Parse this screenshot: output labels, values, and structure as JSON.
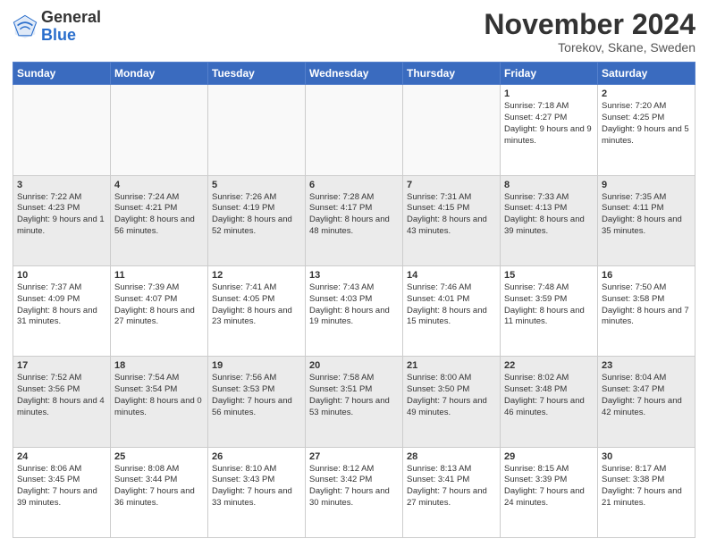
{
  "header": {
    "logo_general": "General",
    "logo_blue": "Blue",
    "month": "November 2024",
    "location": "Torekov, Skane, Sweden"
  },
  "days_of_week": [
    "Sunday",
    "Monday",
    "Tuesday",
    "Wednesday",
    "Thursday",
    "Friday",
    "Saturday"
  ],
  "weeks": [
    [
      {
        "day": "",
        "info": ""
      },
      {
        "day": "",
        "info": ""
      },
      {
        "day": "",
        "info": ""
      },
      {
        "day": "",
        "info": ""
      },
      {
        "day": "",
        "info": ""
      },
      {
        "day": "1",
        "info": "Sunrise: 7:18 AM\nSunset: 4:27 PM\nDaylight: 9 hours and 9 minutes."
      },
      {
        "day": "2",
        "info": "Sunrise: 7:20 AM\nSunset: 4:25 PM\nDaylight: 9 hours and 5 minutes."
      }
    ],
    [
      {
        "day": "3",
        "info": "Sunrise: 7:22 AM\nSunset: 4:23 PM\nDaylight: 9 hours and 1 minute."
      },
      {
        "day": "4",
        "info": "Sunrise: 7:24 AM\nSunset: 4:21 PM\nDaylight: 8 hours and 56 minutes."
      },
      {
        "day": "5",
        "info": "Sunrise: 7:26 AM\nSunset: 4:19 PM\nDaylight: 8 hours and 52 minutes."
      },
      {
        "day": "6",
        "info": "Sunrise: 7:28 AM\nSunset: 4:17 PM\nDaylight: 8 hours and 48 minutes."
      },
      {
        "day": "7",
        "info": "Sunrise: 7:31 AM\nSunset: 4:15 PM\nDaylight: 8 hours and 43 minutes."
      },
      {
        "day": "8",
        "info": "Sunrise: 7:33 AM\nSunset: 4:13 PM\nDaylight: 8 hours and 39 minutes."
      },
      {
        "day": "9",
        "info": "Sunrise: 7:35 AM\nSunset: 4:11 PM\nDaylight: 8 hours and 35 minutes."
      }
    ],
    [
      {
        "day": "10",
        "info": "Sunrise: 7:37 AM\nSunset: 4:09 PM\nDaylight: 8 hours and 31 minutes."
      },
      {
        "day": "11",
        "info": "Sunrise: 7:39 AM\nSunset: 4:07 PM\nDaylight: 8 hours and 27 minutes."
      },
      {
        "day": "12",
        "info": "Sunrise: 7:41 AM\nSunset: 4:05 PM\nDaylight: 8 hours and 23 minutes."
      },
      {
        "day": "13",
        "info": "Sunrise: 7:43 AM\nSunset: 4:03 PM\nDaylight: 8 hours and 19 minutes."
      },
      {
        "day": "14",
        "info": "Sunrise: 7:46 AM\nSunset: 4:01 PM\nDaylight: 8 hours and 15 minutes."
      },
      {
        "day": "15",
        "info": "Sunrise: 7:48 AM\nSunset: 3:59 PM\nDaylight: 8 hours and 11 minutes."
      },
      {
        "day": "16",
        "info": "Sunrise: 7:50 AM\nSunset: 3:58 PM\nDaylight: 8 hours and 7 minutes."
      }
    ],
    [
      {
        "day": "17",
        "info": "Sunrise: 7:52 AM\nSunset: 3:56 PM\nDaylight: 8 hours and 4 minutes."
      },
      {
        "day": "18",
        "info": "Sunrise: 7:54 AM\nSunset: 3:54 PM\nDaylight: 8 hours and 0 minutes."
      },
      {
        "day": "19",
        "info": "Sunrise: 7:56 AM\nSunset: 3:53 PM\nDaylight: 7 hours and 56 minutes."
      },
      {
        "day": "20",
        "info": "Sunrise: 7:58 AM\nSunset: 3:51 PM\nDaylight: 7 hours and 53 minutes."
      },
      {
        "day": "21",
        "info": "Sunrise: 8:00 AM\nSunset: 3:50 PM\nDaylight: 7 hours and 49 minutes."
      },
      {
        "day": "22",
        "info": "Sunrise: 8:02 AM\nSunset: 3:48 PM\nDaylight: 7 hours and 46 minutes."
      },
      {
        "day": "23",
        "info": "Sunrise: 8:04 AM\nSunset: 3:47 PM\nDaylight: 7 hours and 42 minutes."
      }
    ],
    [
      {
        "day": "24",
        "info": "Sunrise: 8:06 AM\nSunset: 3:45 PM\nDaylight: 7 hours and 39 minutes."
      },
      {
        "day": "25",
        "info": "Sunrise: 8:08 AM\nSunset: 3:44 PM\nDaylight: 7 hours and 36 minutes."
      },
      {
        "day": "26",
        "info": "Sunrise: 8:10 AM\nSunset: 3:43 PM\nDaylight: 7 hours and 33 minutes."
      },
      {
        "day": "27",
        "info": "Sunrise: 8:12 AM\nSunset: 3:42 PM\nDaylight: 7 hours and 30 minutes."
      },
      {
        "day": "28",
        "info": "Sunrise: 8:13 AM\nSunset: 3:41 PM\nDaylight: 7 hours and 27 minutes."
      },
      {
        "day": "29",
        "info": "Sunrise: 8:15 AM\nSunset: 3:39 PM\nDaylight: 7 hours and 24 minutes."
      },
      {
        "day": "30",
        "info": "Sunrise: 8:17 AM\nSunset: 3:38 PM\nDaylight: 7 hours and 21 minutes."
      }
    ]
  ]
}
